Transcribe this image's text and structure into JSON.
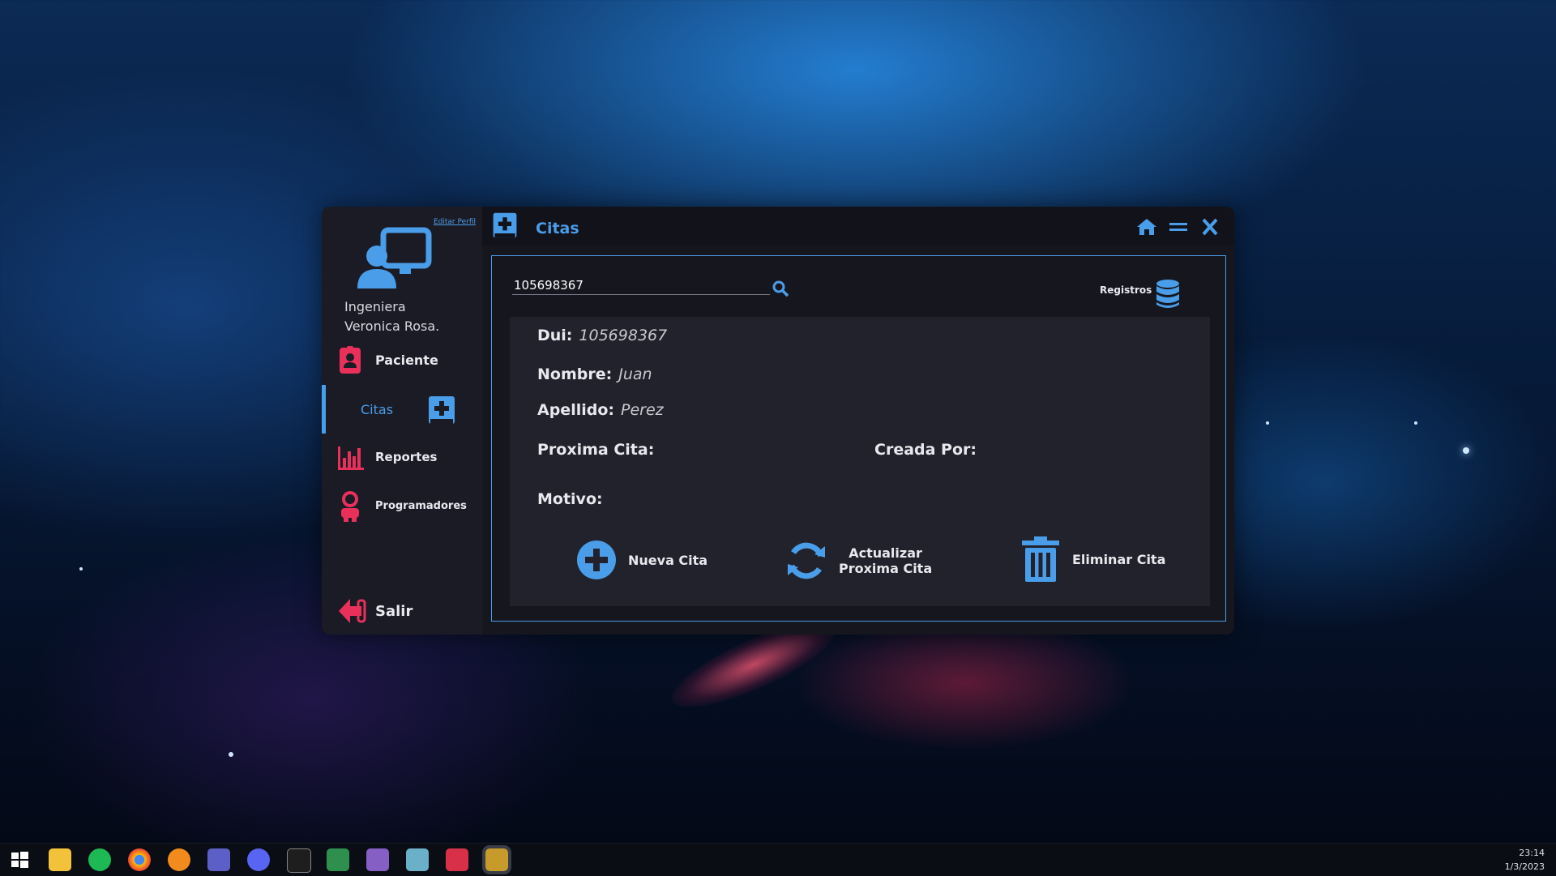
{
  "window": {
    "title": "Citas"
  },
  "sidebar": {
    "edit_profile": "Editar Perfil",
    "user_line1": "Ingeniera",
    "user_line2": "Veronica Rosa.",
    "items": [
      {
        "label": "Paciente",
        "icon": "patient-badge-icon"
      },
      {
        "label": "Citas",
        "icon": "medical-book-icon",
        "active": true
      },
      {
        "label": "Reportes",
        "icon": "bar-chart-icon"
      },
      {
        "label": "Programadores",
        "icon": "astronaut-icon"
      }
    ],
    "logout": "Salir"
  },
  "search": {
    "value": "105698367"
  },
  "registros_label": "Registros",
  "record": {
    "dui_label": "Dui:",
    "dui_value": "105698367",
    "nombre_label": "Nombre:",
    "nombre_value": "Juan",
    "apellido_label": "Apellido:",
    "apellido_value": "Perez",
    "proxima_label": "Proxima Cita:",
    "creada_label": "Creada Por:",
    "motivo_label": "Motivo:"
  },
  "actions": {
    "nueva": "Nueva Cita",
    "actualizar_line1": "Actualizar",
    "actualizar_line2": "Proxima Cita",
    "eliminar": "Eliminar Cita"
  },
  "taskbar": {
    "time": "23:14",
    "date": "1/3/2023"
  },
  "colors": {
    "accent_blue": "#4a9de8",
    "accent_red": "#e8305a",
    "window_bg": "#16161f",
    "sidebar_bg": "#1b1b26"
  }
}
